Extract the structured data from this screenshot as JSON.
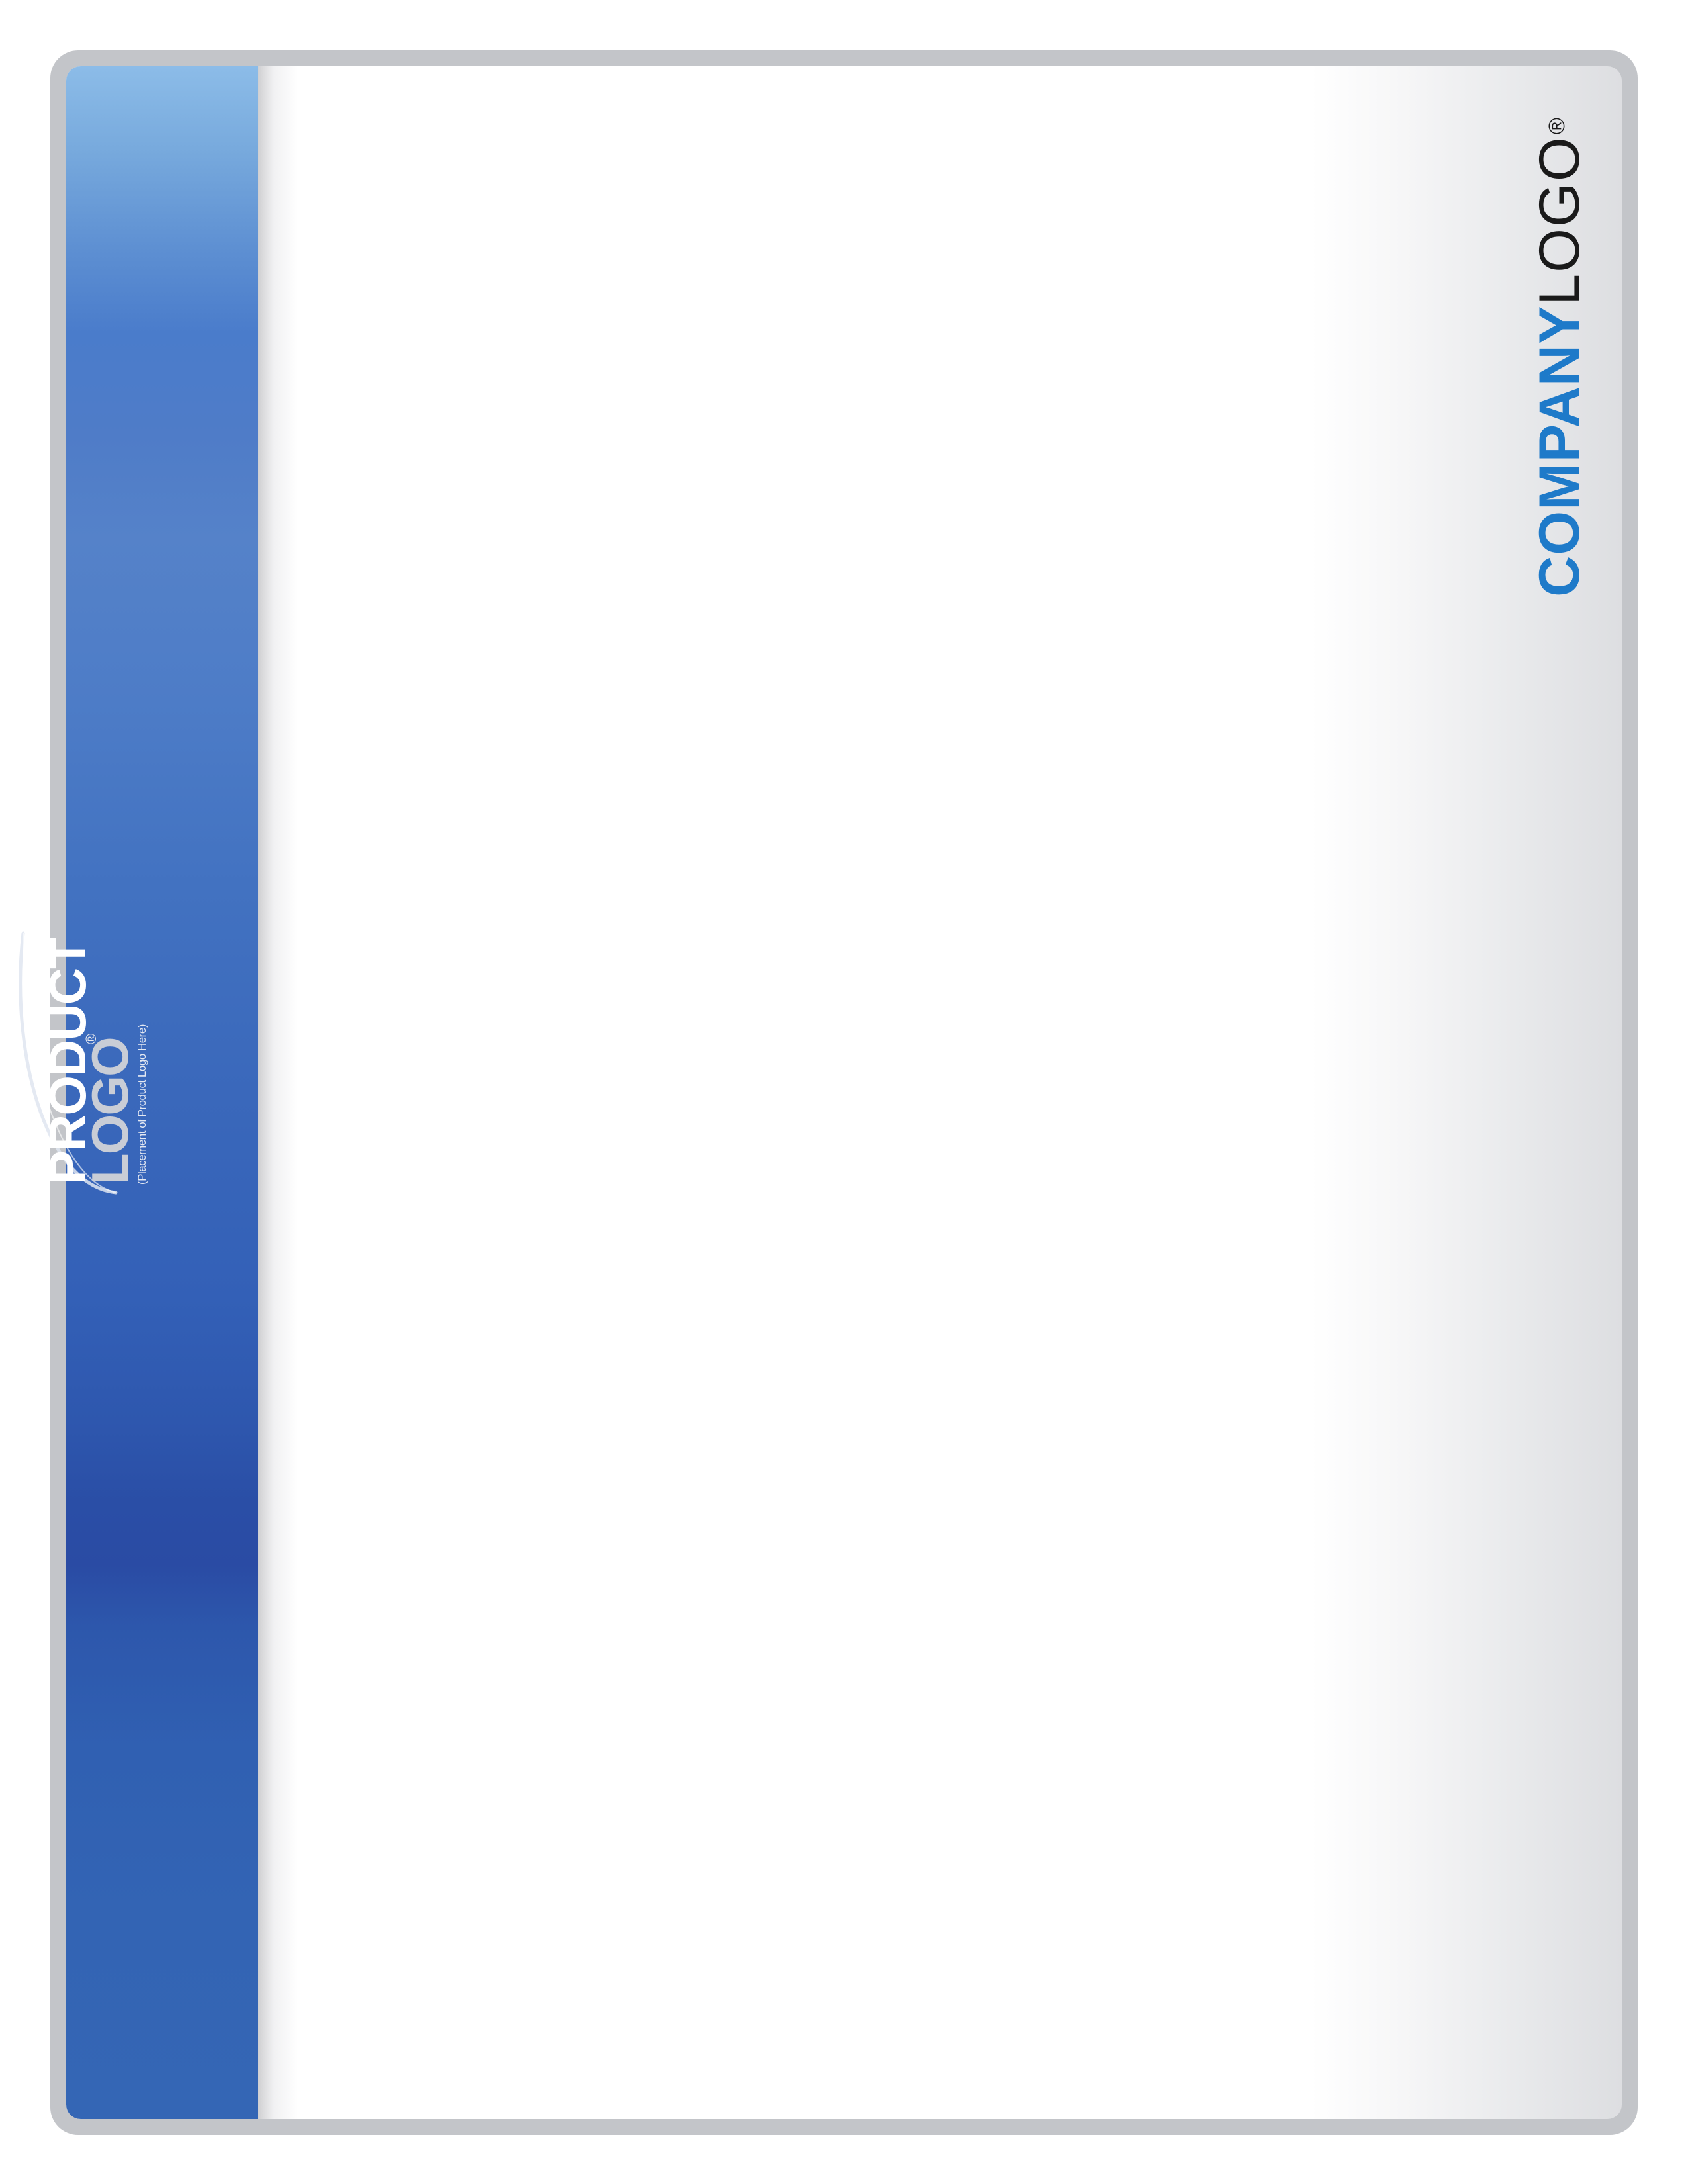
{
  "product_logo": {
    "line1": "PRODUCT",
    "line2": "LOGO",
    "registered": "®",
    "caption": "(Placement of Product Logo Here)"
  },
  "company_logo": {
    "part1": "COMPANY",
    "part2": "LOGO",
    "registered": "®"
  },
  "colors": {
    "band_top": "#8cbce8",
    "band_mid": "#4a7ccb",
    "band_dark": "#2a4ba4",
    "company_blue": "#1e7ac9",
    "frame_gray": "#c3c5c9"
  }
}
